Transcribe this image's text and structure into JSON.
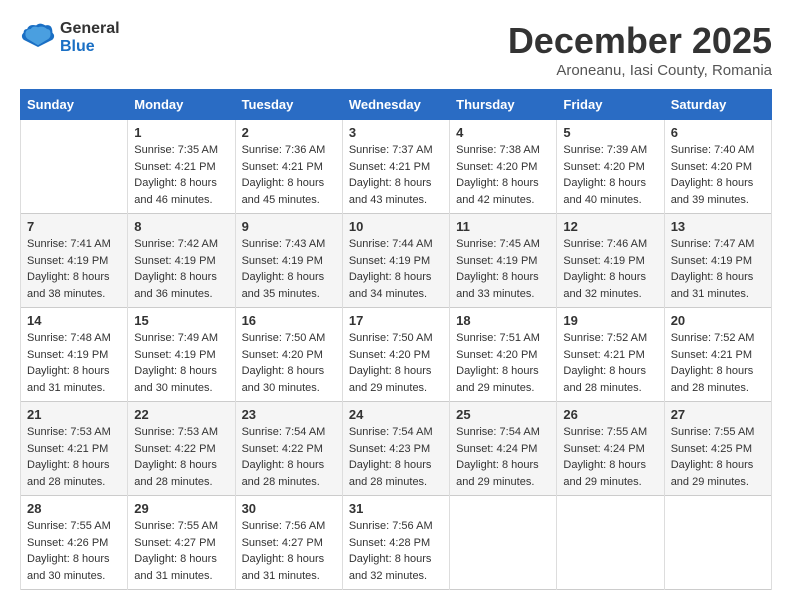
{
  "logo": {
    "line1": "General",
    "line2": "Blue"
  },
  "title": "December 2025",
  "location": "Aroneanu, Iasi County, Romania",
  "days_of_week": [
    "Sunday",
    "Monday",
    "Tuesday",
    "Wednesday",
    "Thursday",
    "Friday",
    "Saturday"
  ],
  "weeks": [
    [
      {
        "day": "",
        "sunrise": "",
        "sunset": "",
        "daylight": ""
      },
      {
        "day": "1",
        "sunrise": "7:35 AM",
        "sunset": "4:21 PM",
        "daylight": "8 hours and 46 minutes."
      },
      {
        "day": "2",
        "sunrise": "7:36 AM",
        "sunset": "4:21 PM",
        "daylight": "8 hours and 45 minutes."
      },
      {
        "day": "3",
        "sunrise": "7:37 AM",
        "sunset": "4:21 PM",
        "daylight": "8 hours and 43 minutes."
      },
      {
        "day": "4",
        "sunrise": "7:38 AM",
        "sunset": "4:20 PM",
        "daylight": "8 hours and 42 minutes."
      },
      {
        "day": "5",
        "sunrise": "7:39 AM",
        "sunset": "4:20 PM",
        "daylight": "8 hours and 40 minutes."
      },
      {
        "day": "6",
        "sunrise": "7:40 AM",
        "sunset": "4:20 PM",
        "daylight": "8 hours and 39 minutes."
      }
    ],
    [
      {
        "day": "7",
        "sunrise": "7:41 AM",
        "sunset": "4:19 PM",
        "daylight": "8 hours and 38 minutes."
      },
      {
        "day": "8",
        "sunrise": "7:42 AM",
        "sunset": "4:19 PM",
        "daylight": "8 hours and 36 minutes."
      },
      {
        "day": "9",
        "sunrise": "7:43 AM",
        "sunset": "4:19 PM",
        "daylight": "8 hours and 35 minutes."
      },
      {
        "day": "10",
        "sunrise": "7:44 AM",
        "sunset": "4:19 PM",
        "daylight": "8 hours and 34 minutes."
      },
      {
        "day": "11",
        "sunrise": "7:45 AM",
        "sunset": "4:19 PM",
        "daylight": "8 hours and 33 minutes."
      },
      {
        "day": "12",
        "sunrise": "7:46 AM",
        "sunset": "4:19 PM",
        "daylight": "8 hours and 32 minutes."
      },
      {
        "day": "13",
        "sunrise": "7:47 AM",
        "sunset": "4:19 PM",
        "daylight": "8 hours and 31 minutes."
      }
    ],
    [
      {
        "day": "14",
        "sunrise": "7:48 AM",
        "sunset": "4:19 PM",
        "daylight": "8 hours and 31 minutes."
      },
      {
        "day": "15",
        "sunrise": "7:49 AM",
        "sunset": "4:19 PM",
        "daylight": "8 hours and 30 minutes."
      },
      {
        "day": "16",
        "sunrise": "7:50 AM",
        "sunset": "4:20 PM",
        "daylight": "8 hours and 30 minutes."
      },
      {
        "day": "17",
        "sunrise": "7:50 AM",
        "sunset": "4:20 PM",
        "daylight": "8 hours and 29 minutes."
      },
      {
        "day": "18",
        "sunrise": "7:51 AM",
        "sunset": "4:20 PM",
        "daylight": "8 hours and 29 minutes."
      },
      {
        "day": "19",
        "sunrise": "7:52 AM",
        "sunset": "4:21 PM",
        "daylight": "8 hours and 28 minutes."
      },
      {
        "day": "20",
        "sunrise": "7:52 AM",
        "sunset": "4:21 PM",
        "daylight": "8 hours and 28 minutes."
      }
    ],
    [
      {
        "day": "21",
        "sunrise": "7:53 AM",
        "sunset": "4:21 PM",
        "daylight": "8 hours and 28 minutes."
      },
      {
        "day": "22",
        "sunrise": "7:53 AM",
        "sunset": "4:22 PM",
        "daylight": "8 hours and 28 minutes."
      },
      {
        "day": "23",
        "sunrise": "7:54 AM",
        "sunset": "4:22 PM",
        "daylight": "8 hours and 28 minutes."
      },
      {
        "day": "24",
        "sunrise": "7:54 AM",
        "sunset": "4:23 PM",
        "daylight": "8 hours and 28 minutes."
      },
      {
        "day": "25",
        "sunrise": "7:54 AM",
        "sunset": "4:24 PM",
        "daylight": "8 hours and 29 minutes."
      },
      {
        "day": "26",
        "sunrise": "7:55 AM",
        "sunset": "4:24 PM",
        "daylight": "8 hours and 29 minutes."
      },
      {
        "day": "27",
        "sunrise": "7:55 AM",
        "sunset": "4:25 PM",
        "daylight": "8 hours and 29 minutes."
      }
    ],
    [
      {
        "day": "28",
        "sunrise": "7:55 AM",
        "sunset": "4:26 PM",
        "daylight": "8 hours and 30 minutes."
      },
      {
        "day": "29",
        "sunrise": "7:55 AM",
        "sunset": "4:27 PM",
        "daylight": "8 hours and 31 minutes."
      },
      {
        "day": "30",
        "sunrise": "7:56 AM",
        "sunset": "4:27 PM",
        "daylight": "8 hours and 31 minutes."
      },
      {
        "day": "31",
        "sunrise": "7:56 AM",
        "sunset": "4:28 PM",
        "daylight": "8 hours and 32 minutes."
      },
      {
        "day": "",
        "sunrise": "",
        "sunset": "",
        "daylight": ""
      },
      {
        "day": "",
        "sunrise": "",
        "sunset": "",
        "daylight": ""
      },
      {
        "day": "",
        "sunrise": "",
        "sunset": "",
        "daylight": ""
      }
    ]
  ]
}
